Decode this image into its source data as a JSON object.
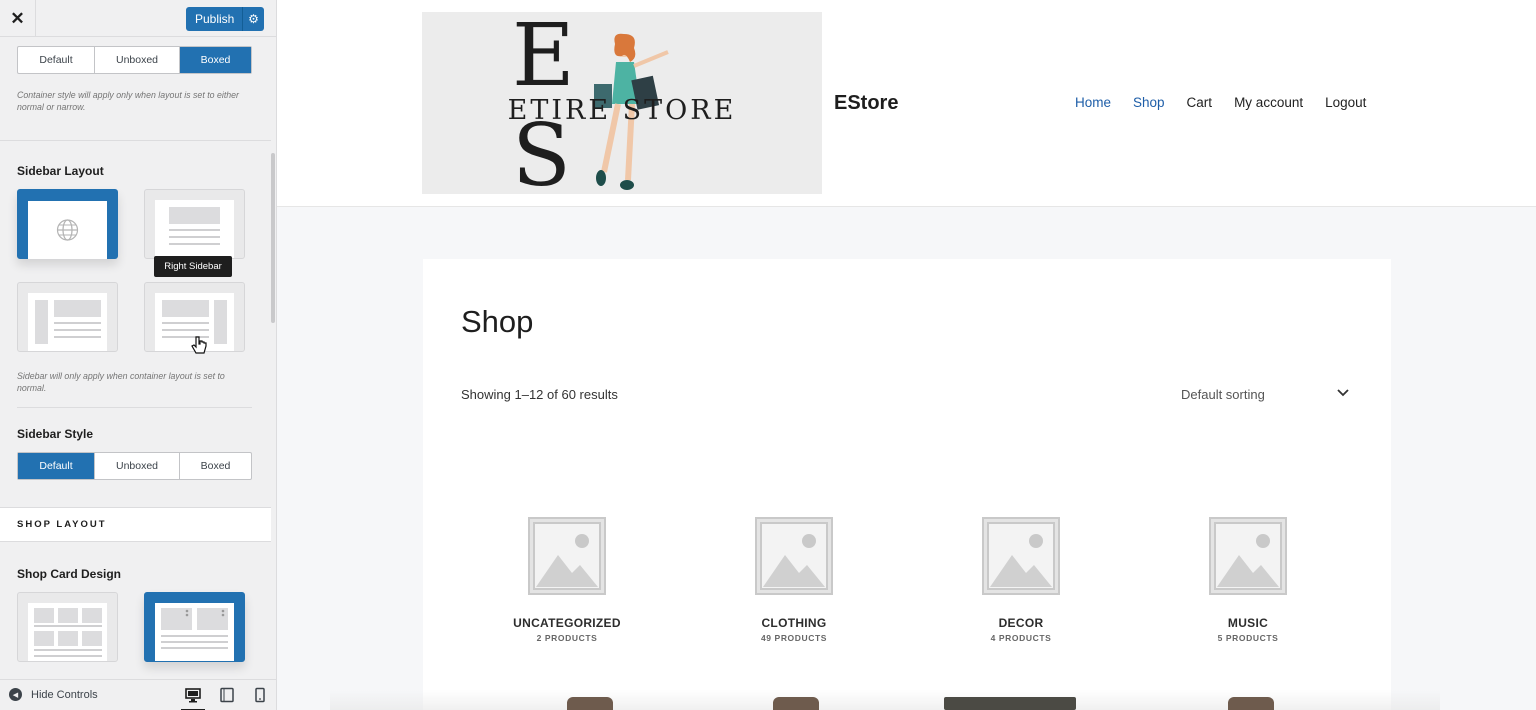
{
  "panel": {
    "close_label": "✕",
    "publish_label": "Publish",
    "container_style": {
      "options": [
        "Default",
        "Unboxed",
        "Boxed"
      ],
      "selected": "Boxed",
      "note": "Container style will apply only when layout is set to either normal or narrow."
    },
    "sidebar_layout": {
      "heading": "Sidebar Layout",
      "tooltip": "Right Sidebar",
      "options": [
        "default",
        "right-sidebar",
        "left-sidebar",
        "right-sidebar-alt"
      ],
      "selected": "default",
      "note": "Sidebar will only apply when container layout is set to normal."
    },
    "sidebar_style": {
      "heading": "Sidebar Style",
      "options": [
        "Default",
        "Unboxed",
        "Boxed"
      ],
      "selected": "Default"
    },
    "shop_layout_section": "SHOP LAYOUT",
    "shop_card_design": {
      "heading": "Shop Card Design",
      "selected": "second"
    },
    "footer": {
      "hide_controls": "Hide Controls",
      "devices": [
        "desktop",
        "tablet",
        "mobile"
      ],
      "active_device": "desktop"
    }
  },
  "site": {
    "logo": {
      "letters": "E S",
      "text": "ETIRE STORE"
    },
    "title": "EStore",
    "nav": [
      "Home",
      "Shop",
      "Cart",
      "My account",
      "Logout"
    ],
    "nav_current": [
      "Home",
      "Shop"
    ],
    "page_title": "Shop",
    "result_count": "Showing 1–12 of 60 results",
    "sorting": "Default sorting",
    "categories": [
      {
        "name": "UNCATEGORIZED",
        "count": "2 PRODUCTS"
      },
      {
        "name": "CLOTHING",
        "count": "49 PRODUCTS"
      },
      {
        "name": "DECOR",
        "count": "4 PRODUCTS"
      },
      {
        "name": "MUSIC",
        "count": "5 PRODUCTS"
      }
    ]
  },
  "colors": {
    "accent": "#2271b1",
    "nav_active": "#1e5ea8",
    "panel_bg": "#f0f0f1",
    "page_bg": "#f6f7f9"
  }
}
